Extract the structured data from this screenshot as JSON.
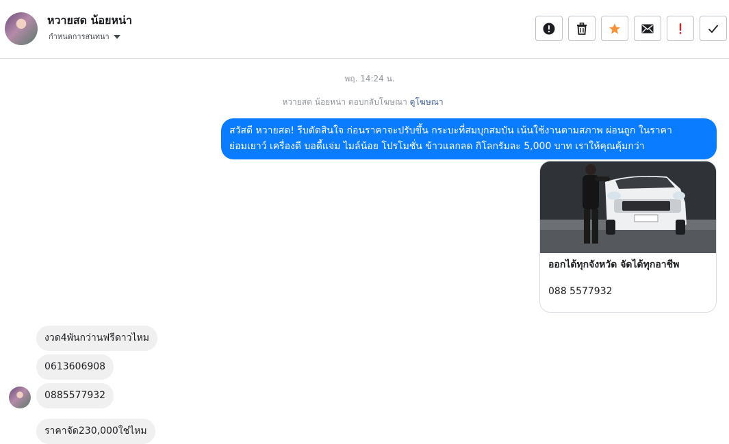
{
  "header": {
    "contact_name": "หวายสด น้อยหน่า",
    "set_nickname": "กำหนดการสนทนา",
    "buttons": [
      {
        "name": "report-button",
        "icon": "alert-circle-icon"
      },
      {
        "name": "delete-button",
        "icon": "trash-icon"
      },
      {
        "name": "star-button",
        "icon": "star-icon",
        "color": "#f7923b"
      },
      {
        "name": "mark-unread-button",
        "icon": "envelope-icon"
      },
      {
        "name": "important-button",
        "icon": "exclamation-icon",
        "color": "#e02020"
      },
      {
        "name": "done-button",
        "icon": "checkmark-icon"
      }
    ]
  },
  "conversation": {
    "timestamp": "พฤ. 14:24 น.",
    "ad_reply_text": "หวายสด น้อยหน่า ตอบกลับโฆษณา",
    "ad_reply_link": "ดูโฆษณา",
    "outgoing_message": {
      "line1": "สวัสดี หวายสด! รีบตัดสินใจ ก่อนราคาจะปรับขึ้น กระบะที่สมบุกสมบัน เน้นใช้งานตามสภาพ ผ่อนถูก ในราคา",
      "line2": "ย่อมเยาว์ เครื่องดี บอดี้แจ่ม ไมล์น้อย โปรโมชั่น ข้าวแลกลด กิโลกรัมละ 5,000 บาท เราให้คุณคุ้มกว่า"
    },
    "ad_card": {
      "title": "ออกได้ทุกจังหวัด จัดได้ทุกอาชีพ",
      "phone": "088 5577932"
    },
    "incoming_messages": [
      "งวด4พันกว่านฟรีดาวไหม",
      "0613606908",
      "0885577932",
      "ราคาจัด230,000ใช่ไหม"
    ]
  },
  "colors": {
    "outgoing_bubble": "#0a7cff",
    "incoming_bubble": "#f0f0f0",
    "link": "#385898"
  }
}
